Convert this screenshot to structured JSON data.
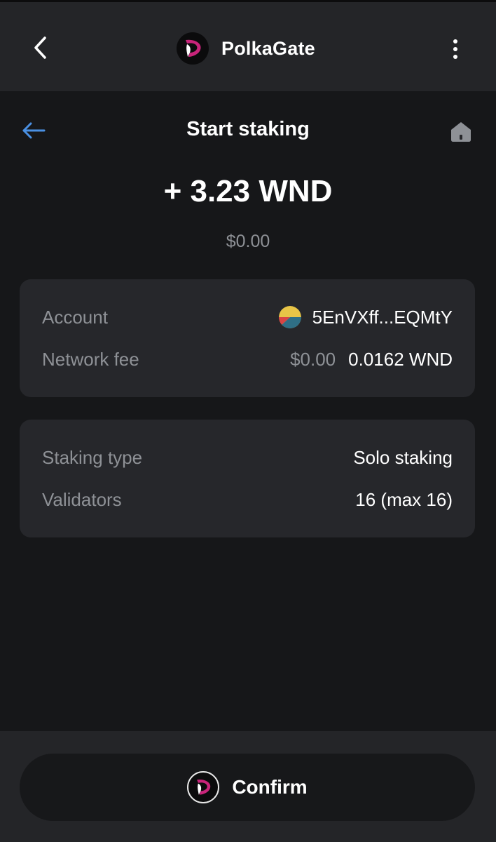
{
  "header": {
    "brand_name": "PolkaGate"
  },
  "page": {
    "title": "Start staking",
    "amount": "+ 3.23 WND",
    "amount_fiat": "$0.00"
  },
  "details": {
    "account_label": "Account",
    "account_value": "5EnVXff...EQMtY",
    "fee_label": "Network fee",
    "fee_fiat": "$0.00",
    "fee_value": "0.0162 WND"
  },
  "staking": {
    "type_label": "Staking type",
    "type_value": "Solo staking",
    "validators_label": "Validators",
    "validators_value": "16 (max 16)"
  },
  "footer": {
    "confirm_label": "Confirm"
  },
  "colors": {
    "background": "#161719",
    "panel": "#242528",
    "card": "#26272b",
    "accent_blue": "#4a90e2",
    "brand_pink": "#c8247a",
    "muted_text": "#8e9196"
  },
  "icons": {
    "back": "chevron-left-icon",
    "menu": "vertical-dots-icon",
    "nav_back": "arrow-left-icon",
    "home": "home-icon",
    "logo": "polkagate-logo-icon",
    "account": "identicon-icon"
  }
}
